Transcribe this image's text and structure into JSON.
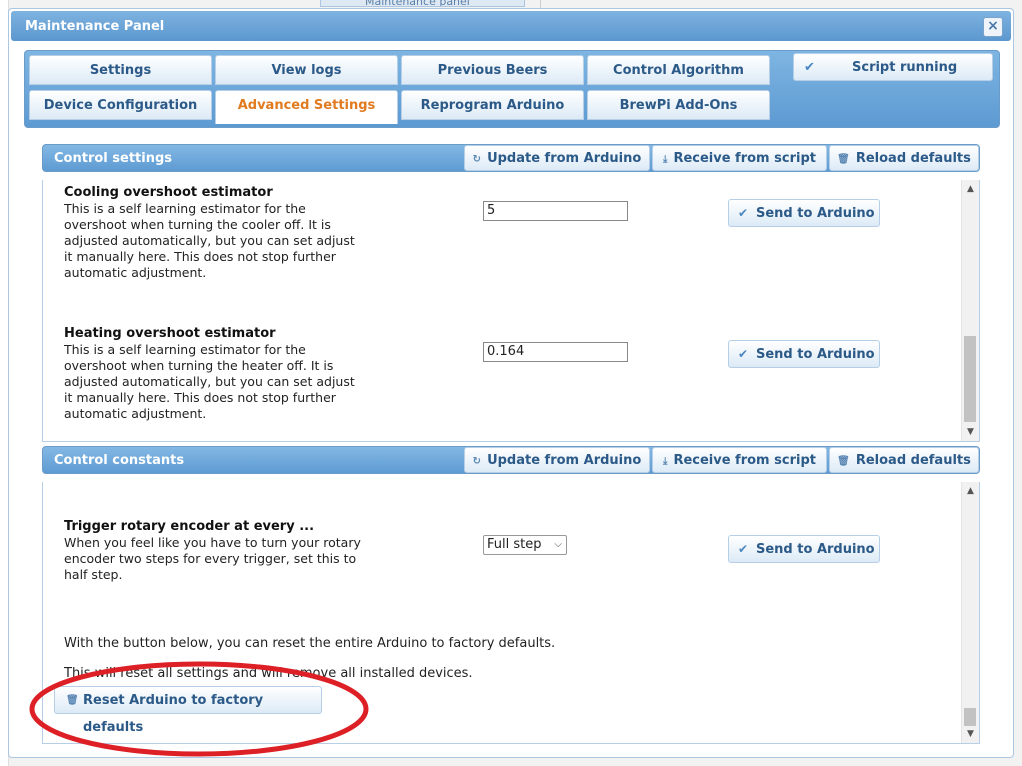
{
  "background": {
    "partial_tab": "Maintenance panel"
  },
  "dialog": {
    "title": "Maintenance Panel",
    "close_symbol": "×"
  },
  "tabs": [
    {
      "label": "Settings"
    },
    {
      "label": "View logs"
    },
    {
      "label": "Previous Beers"
    },
    {
      "label": "Control Algorithm"
    },
    {
      "label": "Device Configuration"
    },
    {
      "label": "Advanced Settings"
    },
    {
      "label": "Reprogram Arduino"
    },
    {
      "label": "BrewPi Add-Ons"
    }
  ],
  "script_status": {
    "label": "Script running",
    "icon": "check-icon"
  },
  "sections": {
    "control_settings": {
      "title": "Control settings",
      "buttons": {
        "update": "Update from Arduino",
        "receive": "Receive from script",
        "reload": "Reload defaults"
      },
      "settings": [
        {
          "title": "Cooling overshoot estimator",
          "desc": [
            "This is a self learning estimator for the",
            "overshoot when turning the cooler off. It is",
            "adjusted automatically, but you can set adjust",
            "it manually here. This does not stop further",
            "automatic adjustment."
          ],
          "value": "5",
          "send": "Send to Arduino"
        },
        {
          "title": "Heating overshoot estimator",
          "desc": [
            "This is a self learning estimator for the",
            "overshoot when turning the heater off. It is",
            "adjusted automatically, but you can set adjust",
            "it manually here. This does not stop further",
            "automatic adjustment."
          ],
          "value": "0.164",
          "send": "Send to Arduino"
        }
      ]
    },
    "control_constants": {
      "title": "Control constants",
      "buttons": {
        "update": "Update from Arduino",
        "receive": "Receive from script",
        "reload": "Reload defaults"
      },
      "rotary": {
        "title": "Trigger rotary encoder at every ...",
        "desc": [
          "When you feel like you have to turn your rotary",
          "encoder two steps for every trigger, set this to",
          "half step."
        ],
        "value": "Full step",
        "send": "Send to Arduino"
      },
      "reset_text_1": "With the button below, you can reset the entire Arduino to factory defaults.",
      "reset_text_2": "This will reset all settings and will remove all installed devices.",
      "reset_button": "Reset Arduino to factory defaults"
    }
  },
  "colors": {
    "annotation": "#dd1f26",
    "accent": "#e07b20",
    "header": "#5e9bd3"
  }
}
